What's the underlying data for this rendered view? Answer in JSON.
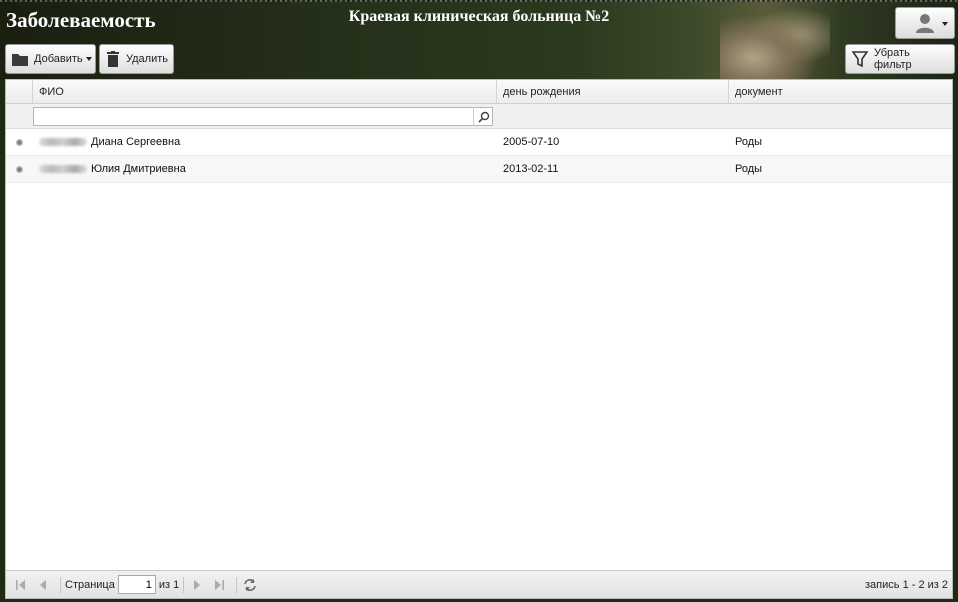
{
  "header": {
    "app_title": "Заболеваемость",
    "hospital_title": "Краевая клиническая больница №2"
  },
  "toolbar": {
    "add_label": "Добавить",
    "delete_label": "Удалить",
    "clear_filter_label": "Убрать фильтр"
  },
  "grid": {
    "columns": [
      "ФИО",
      "день рождения",
      "документ"
    ],
    "filter": {
      "value": ""
    },
    "rows": [
      {
        "name": "Диана Сергеевна",
        "birthday": "2005-07-10",
        "document": "Роды"
      },
      {
        "name": "Юлия Дмитриевна",
        "birthday": "2013-02-11",
        "document": "Роды"
      }
    ]
  },
  "pager": {
    "page_label": "Страница",
    "page_value": "1",
    "of_label": "из 1",
    "info": "запись 1 - 2 из 2"
  },
  "icons": [
    "folder-icon",
    "trash-icon",
    "filter-icon",
    "user-icon",
    "search-icon",
    "first-page-icon",
    "prev-page-icon",
    "next-page-icon",
    "last-page-icon",
    "refresh-icon"
  ]
}
